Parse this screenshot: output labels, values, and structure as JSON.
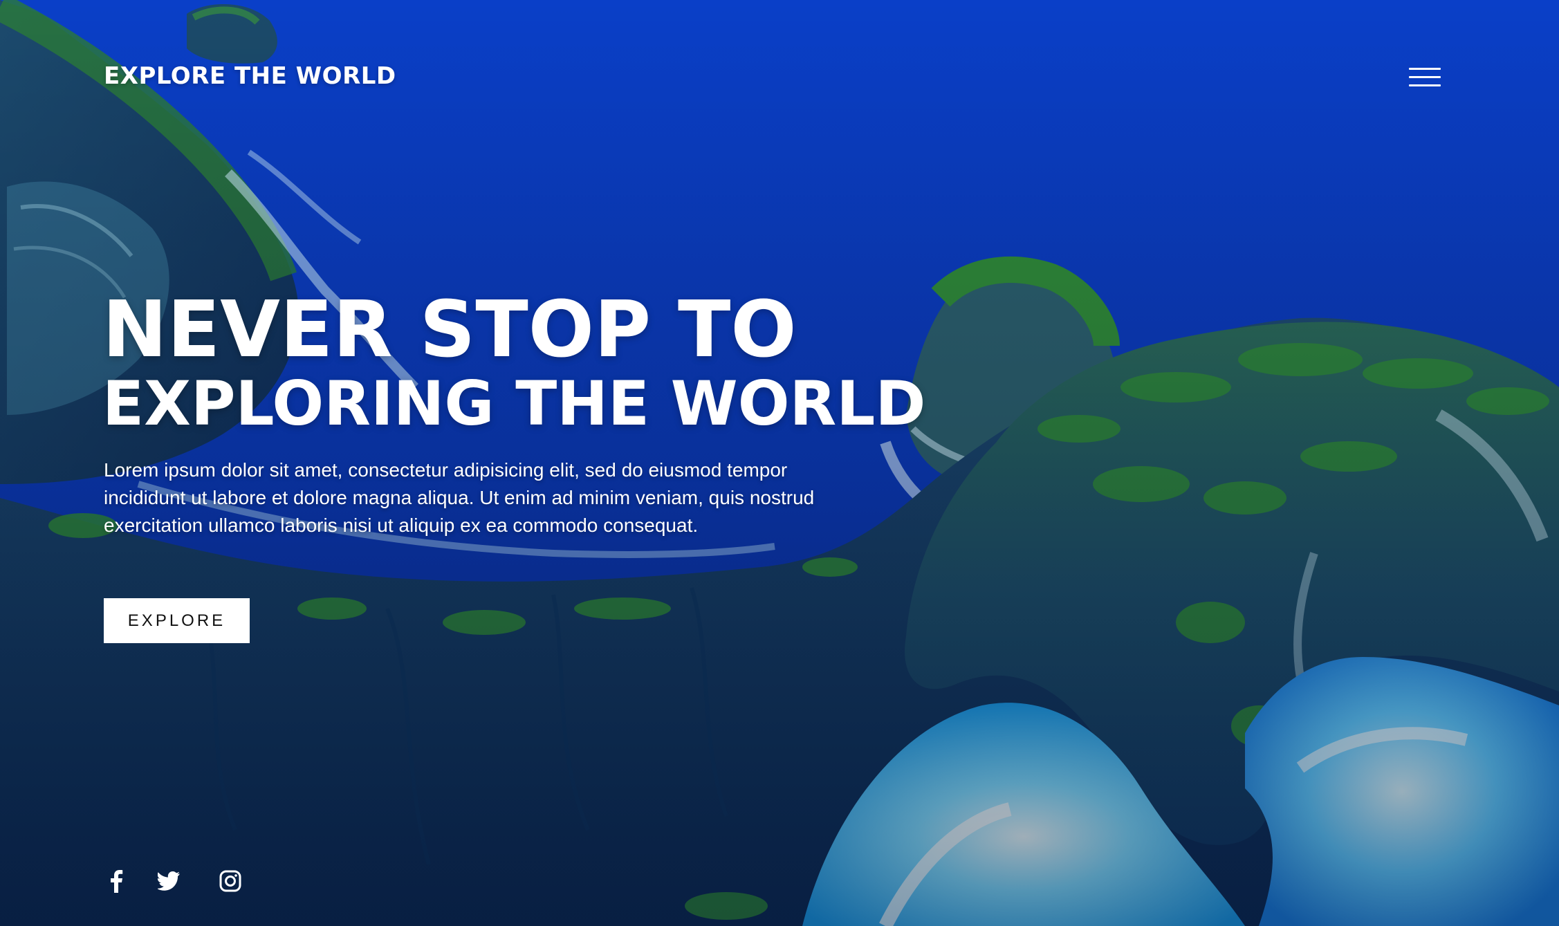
{
  "header": {
    "brand": "EXPLORE THE WORLD",
    "menu_icon": "hamburger-menu-icon"
  },
  "hero": {
    "headline_line1": "NEVER STOP TO",
    "headline_line2": "EXPLORING THE WORLD",
    "body": "Lorem ipsum dolor sit amet, consectetur adipisicing elit, sed do eiusmod tempor incididunt ut labore et dolore magna aliqua. Ut enim ad minim veniam, quis nostrud exercitation ullamco laboris nisi ut aliquip ex ea commodo consequat.",
    "cta_label": "EXPLORE"
  },
  "social": [
    {
      "name": "facebook",
      "icon": "facebook-icon"
    },
    {
      "name": "twitter",
      "icon": "twitter-icon"
    },
    {
      "name": "instagram",
      "icon": "instagram-icon"
    }
  ],
  "colors": {
    "ocean": "#0b3fc4",
    "cliff": "#1a4a7a",
    "vegetation": "#2f8a3a",
    "surf": "#bfe9ff",
    "text": "#ffffff",
    "button_bg": "#ffffff",
    "button_text": "#111111"
  }
}
